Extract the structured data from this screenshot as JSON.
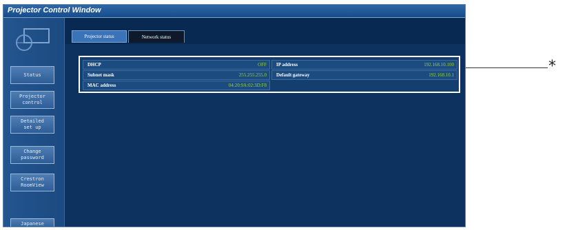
{
  "window": {
    "title": "Projector Control Window"
  },
  "sidebar": {
    "items": [
      {
        "label": "Status"
      },
      {
        "label": "Projector\ncontrol"
      },
      {
        "label": "Detailed\nset up"
      },
      {
        "label": "Change\npassword"
      },
      {
        "label": "Crestron\nRoomView"
      },
      {
        "label": "Japanese"
      }
    ]
  },
  "tabs": {
    "projector_status": "Projector status",
    "network_status": "Network status"
  },
  "network": {
    "dhcp": {
      "label": "DHCP",
      "value": "OFF"
    },
    "ip_address": {
      "label": "IP address",
      "value": "192.168.10.100"
    },
    "subnet_mask": {
      "label": "Subnet mask",
      "value": "255.255.255.0"
    },
    "default_gateway": {
      "label": "Default gateway",
      "value": "192.168.10.1"
    },
    "mac_address": {
      "label": "MAC address",
      "value": "04:20:9A:02:3D:F8"
    }
  },
  "callout": {
    "symbol": "*"
  },
  "colors": {
    "background": "#0d325f",
    "value_text": "#9ad33a",
    "highlight_border": "#ffffff"
  }
}
